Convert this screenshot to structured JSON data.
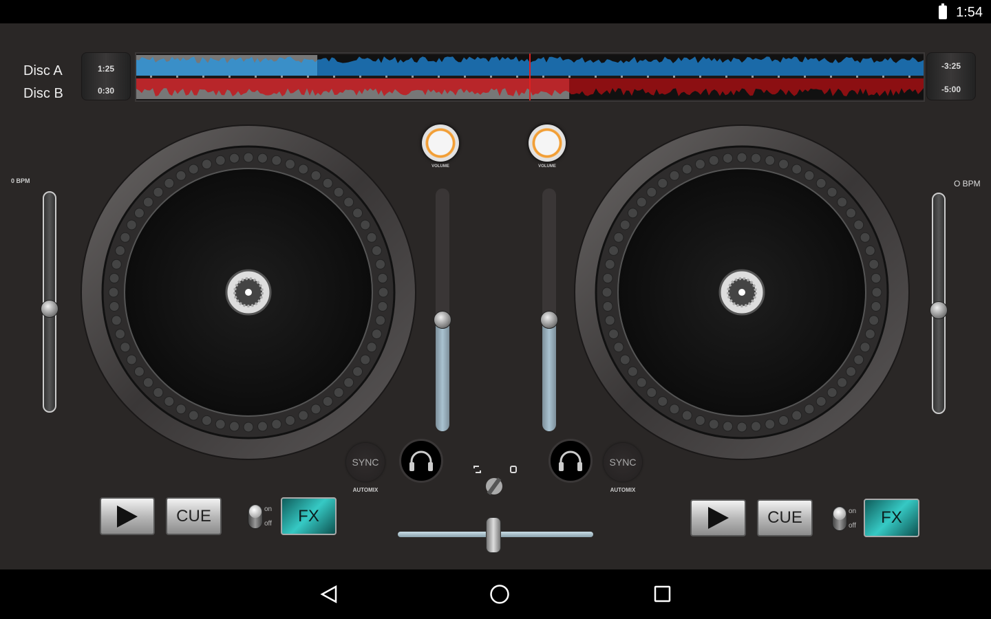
{
  "status_bar": {
    "time": "1:54",
    "battery_icon": "battery-charging-icon"
  },
  "decks": {
    "a": {
      "label": "Disc A",
      "elapsed": "1:25",
      "remaining": "-3:25",
      "progress": 0.23,
      "bpm": "0 BPM",
      "pitch": 0.47,
      "volume_label": "VOLUME",
      "volume_level": 0.46,
      "sync": "SYNC",
      "automix": "AUTOMIX",
      "play_icon": "play-icon",
      "cue": "CUE",
      "fx": "FX",
      "fx_on": "on",
      "fx_off": "off",
      "color": "#3a8fc8"
    },
    "b": {
      "label": "Disc B",
      "elapsed": "0:30",
      "remaining": "-5:00",
      "progress": 0.55,
      "bpm": "O BPM",
      "pitch": 0.47,
      "volume_label": "VOLUME",
      "volume_level": 0.46,
      "sync": "SYNC",
      "automix": "AUTOMIX",
      "play_icon": "play-icon",
      "cue": "CUE",
      "fx": "FX",
      "fx_on": "on",
      "fx_off": "off",
      "color": "#b8262a"
    }
  },
  "mixer": {
    "crossfader": 0.49,
    "playhead": 0.5
  },
  "nav": {
    "back": "back-icon",
    "home": "home-icon",
    "recents": "recents-icon"
  }
}
